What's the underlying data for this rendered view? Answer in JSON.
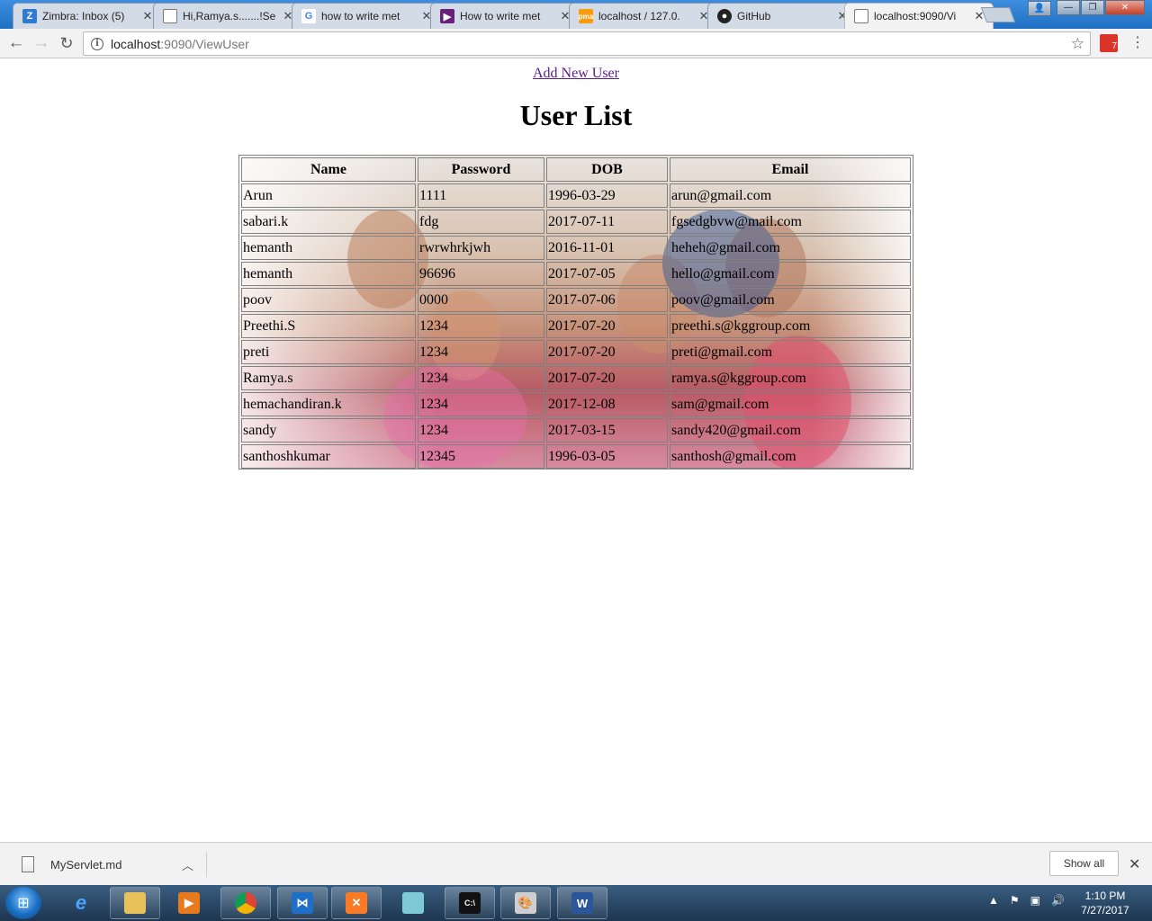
{
  "browser": {
    "tabs": [
      {
        "title": "Zimbra: Inbox (5)",
        "favicon": "zimbra-icon",
        "active": false
      },
      {
        "title": "Hi,Ramya.s.......!Se",
        "favicon": "page-icon",
        "active": false
      },
      {
        "title": "how to write met",
        "favicon": "google-icon",
        "active": false
      },
      {
        "title": "How to write met",
        "favicon": "visual-studio-icon",
        "active": false
      },
      {
        "title": "localhost / 127.0.",
        "favicon": "phpmyadmin-icon",
        "active": false
      },
      {
        "title": "GitHub",
        "favicon": "github-icon",
        "active": false
      },
      {
        "title": "localhost:9090/Vi",
        "favicon": "page-icon",
        "active": true
      }
    ],
    "omnibox": {
      "host": "localhost",
      "path": ":9090/ViewUser"
    }
  },
  "page": {
    "add_link": "Add New User",
    "title": "User List",
    "table": {
      "headers": [
        "Name",
        "Password",
        "DOB",
        "Email"
      ],
      "rows": [
        [
          "Arun",
          "1111",
          "1996-03-29",
          "arun@gmail.com"
        ],
        [
          "sabari.k",
          "fdg",
          "2017-07-11",
          "fgsedgbvw@mail.com"
        ],
        [
          "hemanth",
          "rwrwhrkjwh",
          "2016-11-01",
          "heheh@gmail.com"
        ],
        [
          "hemanth",
          "96696",
          "2017-07-05",
          "hello@gmail.com"
        ],
        [
          "poov",
          "0000",
          "2017-07-06",
          "poov@gmail.com"
        ],
        [
          "Preethi.S",
          "1234",
          "2017-07-20",
          "preethi.s@kggroup.com"
        ],
        [
          "preti",
          "1234",
          "2017-07-20",
          "preti@gmail.com"
        ],
        [
          "Ramya.s",
          "1234",
          "2017-07-20",
          "ramya.s@kggroup.com"
        ],
        [
          "hemachandiran.k",
          "1234",
          "2017-12-08",
          "sam@gmail.com"
        ],
        [
          "sandy",
          "1234",
          "2017-03-15",
          "sandy420@gmail.com"
        ],
        [
          "santhoshkumar",
          "12345",
          "1996-03-05",
          "santhosh@gmail.com"
        ]
      ]
    }
  },
  "download_bar": {
    "file_name": "MyServlet.md",
    "show_all": "Show all"
  },
  "taskbar": {
    "time": "1:10 PM",
    "date": "7/27/2017",
    "apps": [
      "internet-explorer-icon",
      "file-explorer-icon",
      "media-player-icon",
      "chrome-icon",
      "visual-studio-code-icon",
      "xampp-icon",
      "notepad-icon",
      "command-prompt-icon",
      "paint-icon",
      "word-icon"
    ]
  }
}
